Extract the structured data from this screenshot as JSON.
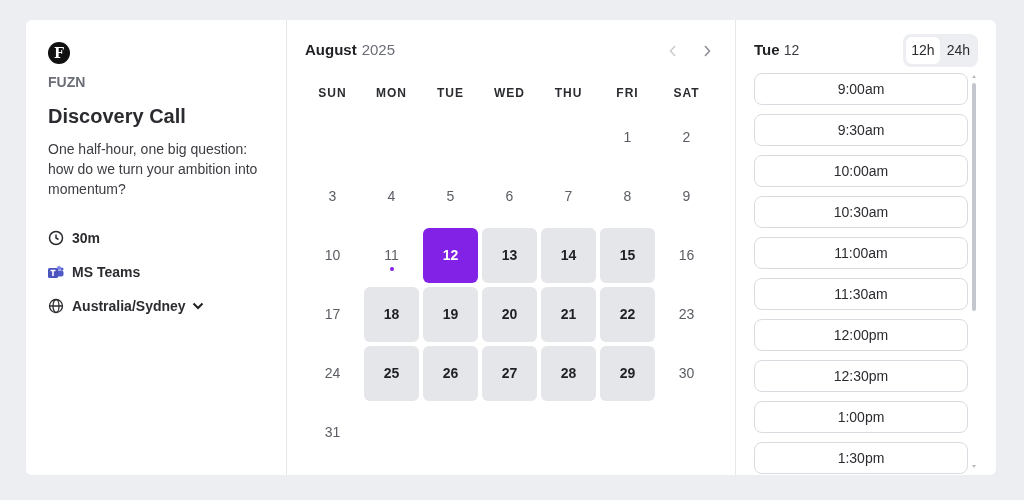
{
  "organizer": {
    "logo": "F",
    "name": "FUZN"
  },
  "event": {
    "title": "Discovery Call",
    "description": "One half-hour, one big question: how do we turn your ambition into momentum?"
  },
  "details": [
    {
      "kind": "duration",
      "label": "30m"
    },
    {
      "kind": "location",
      "label": "MS Teams"
    },
    {
      "kind": "timezone",
      "label": "Australia/Sydney"
    }
  ],
  "calendar": {
    "month": "August",
    "year": "2025",
    "weekdays": [
      "SUN",
      "MON",
      "TUE",
      "WED",
      "THU",
      "FRI",
      "SAT"
    ],
    "weeks": [
      [
        {
          "kind": "padding"
        },
        {
          "kind": "padding"
        },
        {
          "kind": "padding"
        },
        {
          "kind": "padding"
        },
        {
          "kind": "padding"
        },
        {
          "label": "1",
          "available": false,
          "selected": false,
          "today": false
        },
        {
          "label": "2",
          "available": false,
          "selected": false,
          "today": false
        }
      ],
      [
        {
          "label": "3",
          "available": false,
          "selected": false,
          "today": false
        },
        {
          "label": "4",
          "available": false,
          "selected": false,
          "today": false
        },
        {
          "label": "5",
          "available": false,
          "selected": false,
          "today": false
        },
        {
          "label": "6",
          "available": false,
          "selected": false,
          "today": false
        },
        {
          "label": "7",
          "available": false,
          "selected": false,
          "today": false
        },
        {
          "label": "8",
          "available": false,
          "selected": false,
          "today": false
        },
        {
          "label": "9",
          "available": false,
          "selected": false,
          "today": false
        }
      ],
      [
        {
          "label": "10",
          "available": false,
          "selected": false,
          "today": false
        },
        {
          "label": "11",
          "available": false,
          "selected": false,
          "today": true
        },
        {
          "label": "12",
          "available": true,
          "selected": true,
          "today": false
        },
        {
          "label": "13",
          "available": true,
          "selected": false,
          "today": false
        },
        {
          "label": "14",
          "available": true,
          "selected": false,
          "today": false
        },
        {
          "label": "15",
          "available": true,
          "selected": false,
          "today": false
        },
        {
          "label": "16",
          "available": false,
          "selected": false,
          "today": false
        }
      ],
      [
        {
          "label": "17",
          "available": false,
          "selected": false,
          "today": false
        },
        {
          "label": "18",
          "available": true,
          "selected": false,
          "today": false
        },
        {
          "label": "19",
          "available": true,
          "selected": false,
          "today": false
        },
        {
          "label": "20",
          "available": true,
          "selected": false,
          "today": false
        },
        {
          "label": "21",
          "available": true,
          "selected": false,
          "today": false
        },
        {
          "label": "22",
          "available": true,
          "selected": false,
          "today": false
        },
        {
          "label": "23",
          "available": false,
          "selected": false,
          "today": false
        }
      ],
      [
        {
          "label": "24",
          "available": false,
          "selected": false,
          "today": false
        },
        {
          "label": "25",
          "available": true,
          "selected": false,
          "today": false
        },
        {
          "label": "26",
          "available": true,
          "selected": false,
          "today": false
        },
        {
          "label": "27",
          "available": true,
          "selected": false,
          "today": false
        },
        {
          "label": "28",
          "available": true,
          "selected": false,
          "today": false
        },
        {
          "label": "29",
          "available": true,
          "selected": false,
          "today": false
        },
        {
          "label": "30",
          "available": false,
          "selected": false,
          "today": false
        }
      ],
      [
        {
          "label": "31",
          "available": false,
          "selected": false,
          "today": false
        }
      ]
    ]
  },
  "slots": {
    "day": "Tue",
    "date": "12",
    "formats": [
      {
        "label": "12h",
        "selected": true
      },
      {
        "label": "24h",
        "selected": false
      }
    ],
    "times": [
      "9:00am",
      "9:30am",
      "10:00am",
      "10:30am",
      "11:00am",
      "11:30am",
      "12:00pm",
      "12:30pm",
      "1:00pm",
      "1:30pm"
    ]
  }
}
